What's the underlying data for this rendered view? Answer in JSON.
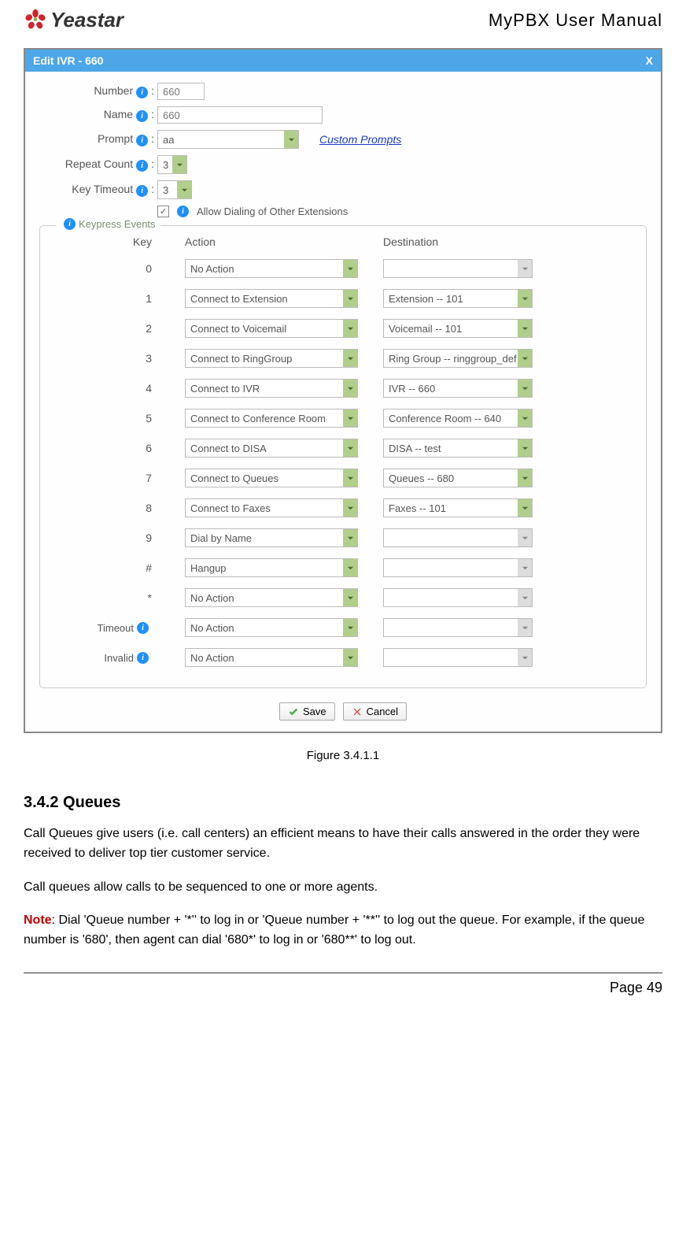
{
  "header": {
    "logo_text": "Yeastar",
    "title": "MyPBX  User  Manual"
  },
  "panel": {
    "title": "Edit IVR - 660",
    "close": "X",
    "form": {
      "number_label": "Number",
      "number_value": "660",
      "name_label": "Name",
      "name_value": "660",
      "prompt_label": "Prompt",
      "prompt_value": "aa",
      "custom_prompts": "Custom Prompts",
      "repeat_label": "Repeat Count",
      "repeat_value": "3",
      "timeout_label": "Key Timeout",
      "timeout_value": "3",
      "allow_dial_label": "Allow Dialing of Other Extensions"
    },
    "keypress": {
      "legend": "Keypress Events",
      "col_key": "Key",
      "col_action": "Action",
      "col_dest": "Destination",
      "rows": [
        {
          "key": "0",
          "action": "No Action",
          "dest": "",
          "dest_disabled": true
        },
        {
          "key": "1",
          "action": "Connect to Extension",
          "dest": "Extension -- 101",
          "dest_disabled": false
        },
        {
          "key": "2",
          "action": "Connect to Voicemail",
          "dest": "Voicemail -- 101",
          "dest_disabled": false
        },
        {
          "key": "3",
          "action": "Connect to RingGroup",
          "dest": "Ring Group -- ringgroup_def",
          "dest_disabled": false
        },
        {
          "key": "4",
          "action": "Connect to IVR",
          "dest": "IVR -- 660",
          "dest_disabled": false
        },
        {
          "key": "5",
          "action": "Connect to Conference Room",
          "dest": "Conference Room -- 640",
          "dest_disabled": false
        },
        {
          "key": "6",
          "action": "Connect to DISA",
          "dest": "DISA -- test",
          "dest_disabled": false
        },
        {
          "key": "7",
          "action": "Connect to Queues",
          "dest": "Queues -- 680",
          "dest_disabled": false
        },
        {
          "key": "8",
          "action": "Connect to Faxes",
          "dest": "Faxes -- 101",
          "dest_disabled": false
        },
        {
          "key": "9",
          "action": "Dial by Name",
          "dest": "",
          "dest_disabled": true
        },
        {
          "key": "#",
          "action": "Hangup",
          "dest": "",
          "dest_disabled": true
        },
        {
          "key": "*",
          "action": "No Action",
          "dest": "",
          "dest_disabled": true
        }
      ],
      "timeout_label": "Timeout",
      "timeout_action": "No Action",
      "invalid_label": "Invalid",
      "invalid_action": "No Action"
    },
    "buttons": {
      "save": "Save",
      "cancel": "Cancel"
    }
  },
  "figure_caption": "Figure 3.4.1.1",
  "section": {
    "heading": "3.4.2 Queues",
    "para1": "Call Queues give users (i.e. call centers) an efficient means to have their calls answered in the order they were received to deliver top tier customer service.",
    "para2": "Call queues allow calls to be sequenced to one or more agents.",
    "note_label": "Note",
    "note_text": ": Dial 'Queue number + '*'' to log in or 'Queue number + '**'' to log out the queue. For example, if the queue number is '680', then agent can dial '680*' to log in or '680**' to log out."
  },
  "footer": {
    "page": "Page 49"
  }
}
